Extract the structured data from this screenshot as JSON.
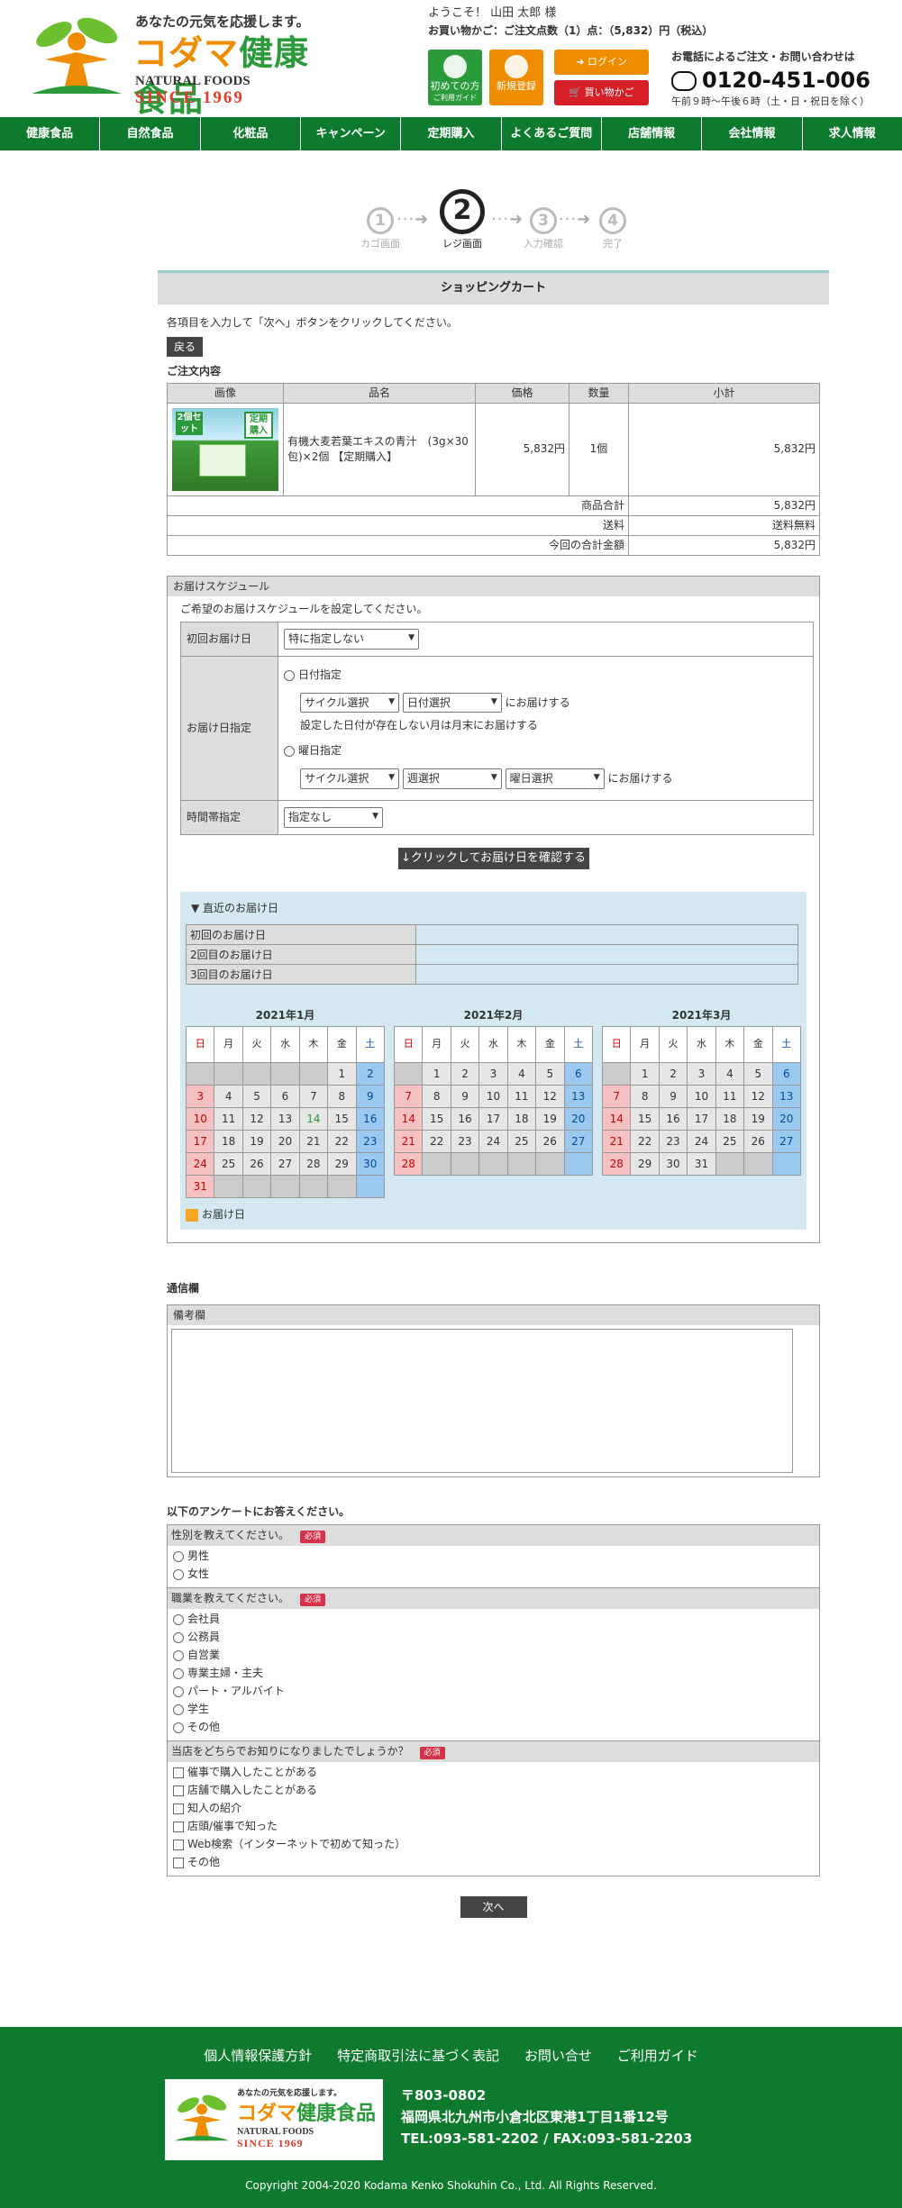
{
  "header": {
    "tagline": "あなたの元気を応援します。",
    "brand_kodama": "コダマ",
    "brand_kenko": "健康食品",
    "brand_en": "NATURAL FOODS",
    "since": "SINCE 1969",
    "welcome": "ようこそ！ 山田 太郎 様",
    "cart_summary": "お買い物かご：ご注文点数（1）点：（5,832）円（税込）",
    "btn_first": "初めての方",
    "btn_first_sub": "ご利用ガイド",
    "btn_register": "新規登録",
    "btn_login": "ログイン",
    "btn_cart": "買い物かご",
    "phone_title": "お電話によるご注文・お問い合わせは",
    "phone_number": "0120-451-006",
    "phone_hours": "午前９時～午後６時（土・日・祝日を除く）"
  },
  "nav": [
    "健康食品",
    "自然食品",
    "化粧品",
    "キャンペーン",
    "定期購入",
    "よくあるご質問",
    "店舗情報",
    "会社情報",
    "求人情報"
  ],
  "steps": [
    {
      "num": "1",
      "label": "カゴ画面"
    },
    {
      "num": "2",
      "label": "レジ画面"
    },
    {
      "num": "3",
      "label": "入力確認"
    },
    {
      "num": "4",
      "label": "完了"
    }
  ],
  "cart": {
    "title": "ショッピングカート",
    "description": "各項目を入力して「次へ」ボタンをクリックしてください。",
    "back": "戻る",
    "order_heading": "ご注文内容",
    "columns": [
      "画像",
      "品名",
      "価格",
      "数量",
      "小計"
    ],
    "item": {
      "badge_left": "2個セット",
      "badge_right": "定期購入",
      "name": "有機大麦若葉エキスの青汁　(3g×30包)×2個 【定期購入】",
      "price": "5,832円",
      "qty": "1個",
      "subtotal": "5,832円"
    },
    "totals": [
      {
        "label": "商品合計",
        "value": "5,832円"
      },
      {
        "label": "送料",
        "value": "送料無料"
      },
      {
        "label": "今回の合計金額",
        "value": "5,832円"
      }
    ]
  },
  "schedule": {
    "heading": "お届けスケジュール",
    "intro": "ご希望のお届けスケジュールを設定してください。",
    "first_label": "初回お届け日",
    "first_value": "特に指定しない",
    "spec_label": "お届け日指定",
    "date_option": "日付指定",
    "cycle_select": "サイクル選択",
    "date_select": "日付選択",
    "deliver_text": "にお届けする",
    "note": "設定した日付が存在しない月は月末にお届けする",
    "weekday_option": "曜日指定",
    "week_select": "週選択",
    "weekday_select": "曜日選択",
    "time_label": "時間帯指定",
    "time_value": "指定なし",
    "confirm_btn": "↓クリックしてお届け日を確認する"
  },
  "recent": {
    "title": "▼ 直近のお届け日",
    "rows": [
      "初回のお届け日",
      "2回目のお届け日",
      "3回目のお届け日"
    ],
    "legend": "お届け日"
  },
  "calendars": [
    {
      "title": "2021年1月",
      "offset": 5,
      "days": 31,
      "today": 14
    },
    {
      "title": "2021年2月",
      "offset": 1,
      "days": 28,
      "today": 0
    },
    {
      "title": "2021年3月",
      "offset": 1,
      "days": 31,
      "today": 0
    }
  ],
  "weekdays": [
    "日",
    "月",
    "火",
    "水",
    "木",
    "金",
    "土"
  ],
  "comm": {
    "label": "通信欄",
    "remark_heading": "備考欄"
  },
  "survey": {
    "intro": "以下のアンケートにお答えください。",
    "required": "必須",
    "questions": [
      {
        "q": "性別を教えてください。",
        "type": "radio",
        "options": [
          "男性",
          "女性"
        ]
      },
      {
        "q": "職業を教えてください。",
        "type": "radio",
        "options": [
          "会社員",
          "公務員",
          "自営業",
          "専業主婦・主夫",
          "パート・アルバイト",
          "学生",
          "その他"
        ]
      },
      {
        "q": "当店をどちらでお知りになりましたでしょうか？",
        "type": "check",
        "options": [
          "催事で購入したことがある",
          "店舗で購入したことがある",
          "知人の紹介",
          "店頭/催事で知った",
          "Web検索（インターネットで初めて知った）",
          "その他"
        ]
      }
    ],
    "next": "次へ"
  },
  "footer": {
    "links": [
      "個人情報保護方針",
      "特定商取引法に基づく表記",
      "お問い合せ",
      "ご利用ガイド"
    ],
    "tagline": "あなたの元気を応援します。",
    "brand_kodama": "コダマ",
    "brand_kenko": "健康食品",
    "brand_en": "NATURAL FOODS",
    "since": "SINCE 1969",
    "postal": "〒803-0802",
    "address": "福岡県北九州市小倉北区東港1丁目1番12号",
    "tel": "TEL:093-581-2202 / FAX:093-581-2203",
    "copyright": "Copyright 2004-2020 Kodama Kenko Shokuhin Co., Ltd. All Rights Reserved."
  }
}
